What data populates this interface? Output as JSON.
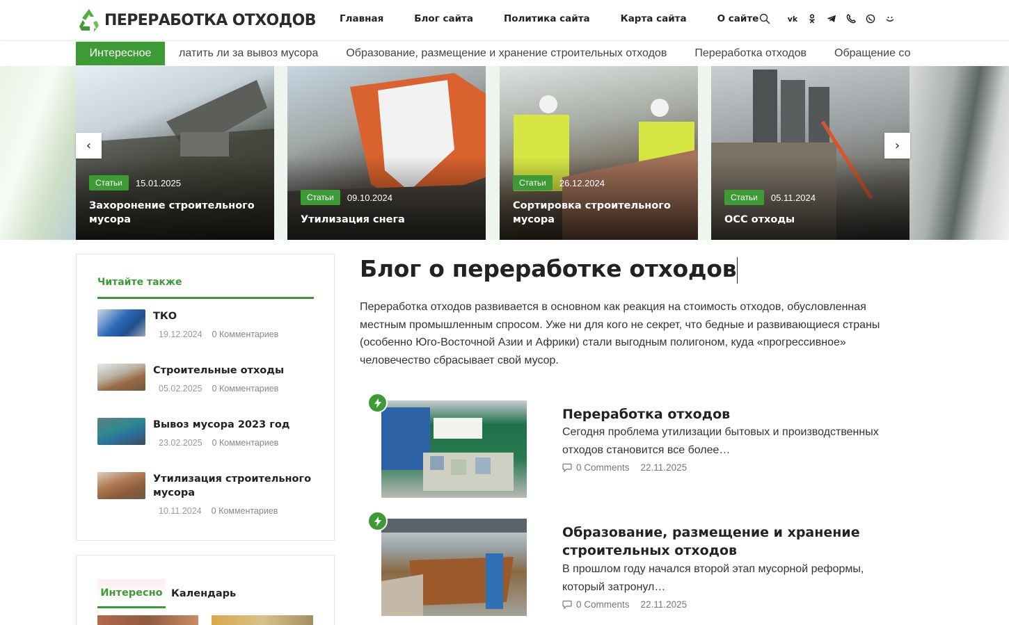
{
  "header": {
    "logo_text": "ПЕРЕРАБОТКА ОТХОДОВ",
    "nav": [
      "Главная",
      "Блог сайта",
      "Политика сайта",
      "Карта сайта",
      "О сайте"
    ],
    "icons": [
      "search-icon",
      "vk-icon",
      "odnoklassniki-icon",
      "telegram-icon",
      "viber-icon",
      "whatsapp-icon",
      "mail-ru-icon"
    ]
  },
  "ticker": {
    "label": "Интересное",
    "items": [
      "латить ли за вывоз мусора",
      "Образование, размещение и хранение строительных отходов",
      "Переработка отходов",
      "Обращение со с"
    ]
  },
  "slider": {
    "slides": [
      {
        "badge": "Статьи",
        "date": "15.01.2025",
        "title": "Захоронение строительного мусора"
      },
      {
        "badge": "Статьи",
        "date": "09.10.2024",
        "title": "Утилизация снега"
      },
      {
        "badge": "Статьи",
        "date": "26.12.2024",
        "title": "Сортировка строительного мусора"
      },
      {
        "badge": "Статьи",
        "date": "05.11.2024",
        "title": "ОСС отходы"
      }
    ]
  },
  "sidebar": {
    "read_also": {
      "title": "Читайте также",
      "items": [
        {
          "title": "ТКО",
          "date": "19.12.2024",
          "comments": "0 Комментариев"
        },
        {
          "title": "Строительные отходы",
          "date": "05.02.2025",
          "comments": "0 Комментариев"
        },
        {
          "title": "Вывоз мусора 2023 год",
          "date": "23.02.2025",
          "comments": "0 Комментариев"
        },
        {
          "title": "Утилизация строительного мусора",
          "date": "10.11.2024",
          "comments": "0 Комментариев"
        }
      ]
    },
    "tabs": [
      "Интересно",
      "Календарь"
    ]
  },
  "main": {
    "title": "Блог о переработке отходов",
    "intro": "Переработка отходов развивается в основном как реакция на стоимость отходов, обусловленная местным промышленным спросом. Уже ни для кого не секрет, что бедные и развивающиеся страны (особенно Юго-Восточной Азии и Африки) стали выгодным полигоном, куда «прогрессивное» человечество сбрасывает свой мусор.",
    "posts": [
      {
        "title": "Переработка отходов",
        "excerpt": "Сегодня проблема утилизации бытовых и производственных отходов становится все более…",
        "comments": "0 Comments",
        "date": "22.11.2025"
      },
      {
        "title": "Образование, размещение и хранение строительных отходов",
        "excerpt": "В прошлом году начался второй этап мусорной реформы, который затронул…",
        "comments": "0 Comments",
        "date": "22.11.2025"
      }
    ]
  },
  "colors": {
    "accent": "#3d9b35",
    "text": "#222222",
    "muted": "#999999"
  }
}
